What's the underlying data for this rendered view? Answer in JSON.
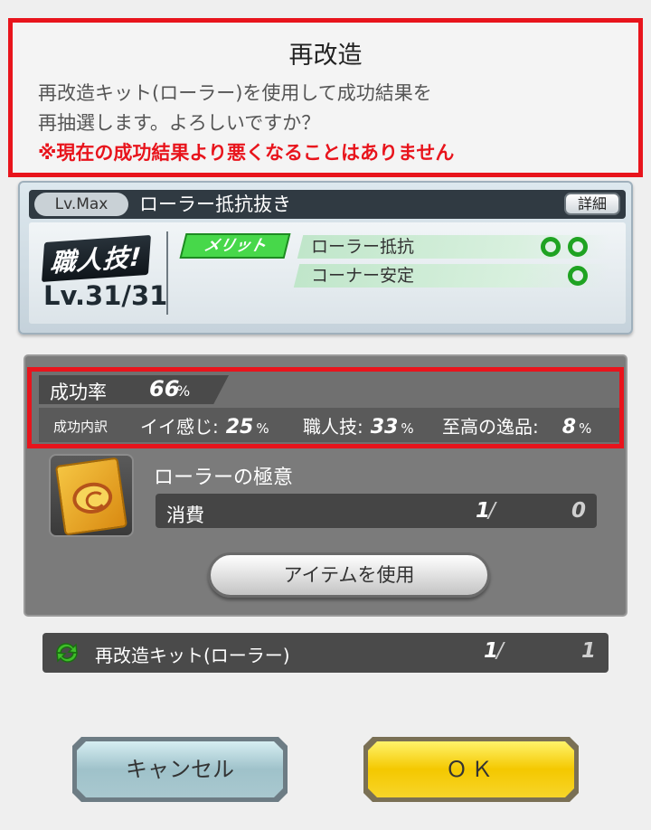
{
  "dialog": {
    "title": "再改造",
    "message": "再改造キット(ローラー)を使用して成功結果を\n再抽選します。よろしいですか？",
    "warning": "※現在の成功結果より悪くなることはありません"
  },
  "skill": {
    "level_badge": "Lv.Max",
    "name": "ローラー抵抗抜き",
    "detail_button": "詳細",
    "craft_logo": "職人技!",
    "craft_level": "Lv.31/31",
    "merit_tag": "メリット",
    "effects": [
      {
        "label": "ローラー抵抗",
        "rating": 2
      },
      {
        "label": "コーナー安定",
        "rating": 1
      }
    ]
  },
  "success": {
    "rate_label": "成功率",
    "rate_value": "66",
    "rate_unit": "%",
    "breakdown_label": "成功内訳",
    "breakdown": [
      {
        "label": "イイ感じ:",
        "value": "25",
        "unit": "%"
      },
      {
        "label": "職人技:",
        "value": "33",
        "unit": "%"
      },
      {
        "label": "至高の逸品:",
        "value": "8",
        "unit": "%"
      }
    ]
  },
  "item": {
    "name": "ローラーの極意",
    "consume_label": "消費",
    "consume_have": "1",
    "slash": "/",
    "consume_need": "0",
    "use_button": "アイテムを使用"
  },
  "kit": {
    "name": "再改造キット(ローラー)",
    "have": "1",
    "slash": "/",
    "total": "1",
    "icon_color": "#3fbf2a"
  },
  "buttons": {
    "cancel": "キャンセル",
    "ok": "ＯＫ"
  },
  "colors": {
    "highlight_red": "#e8141c",
    "merit_green": "#47d84a",
    "ok_yellow": "#f4c800"
  }
}
